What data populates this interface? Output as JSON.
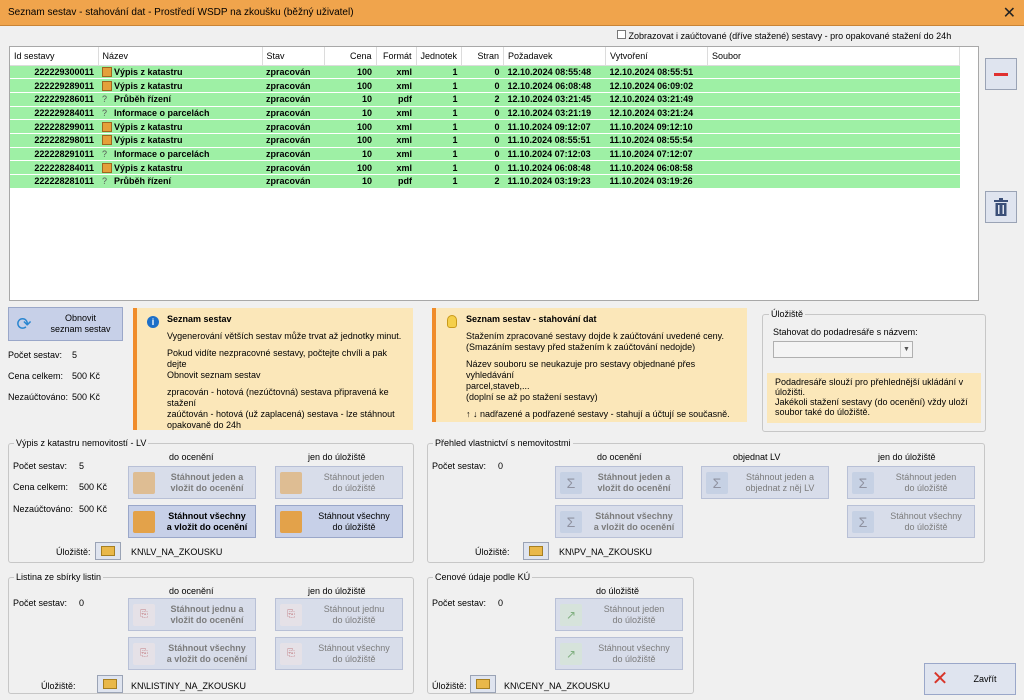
{
  "window": {
    "title": "Seznam sestav - stahování dat  - Prostředí WSDP na zkoušku (běžný uživatel)",
    "close": "✕"
  },
  "toggle_billed": "Zobrazovat i zaúčtované (dříve stažené) sestavy - pro opakované stažení do 24h",
  "grid": {
    "columns": [
      "Id sestavy",
      "Název",
      "Stav",
      "Cena",
      "Formát",
      "Jednotek",
      "Stran",
      "Požadavek",
      "Vytvoření",
      "Soubor"
    ],
    "rows": [
      {
        "id": "222229300011",
        "icon": "scroll",
        "name": "Výpis z katastru",
        "state": "zpracován",
        "price": "100",
        "format": "xml",
        "units": "1",
        "pages": "0",
        "requested": "12.10.2024 08:55:48",
        "created": "12.10.2024 08:55:51",
        "file": ""
      },
      {
        "id": "222229289011",
        "icon": "scroll",
        "name": "Výpis z katastru",
        "state": "zpracován",
        "price": "100",
        "format": "xml",
        "units": "1",
        "pages": "0",
        "requested": "12.10.2024 06:08:48",
        "created": "12.10.2024 06:09:02",
        "file": ""
      },
      {
        "id": "222229286011",
        "icon": "question",
        "name": "Průběh řízení",
        "state": "zpracován",
        "price": "10",
        "format": "pdf",
        "units": "1",
        "pages": "2",
        "requested": "12.10.2024 03:21:45",
        "created": "12.10.2024 03:21:49",
        "file": ""
      },
      {
        "id": "222229284011",
        "icon": "question",
        "name": "Informace o parcelách",
        "state": "zpracován",
        "price": "10",
        "format": "xml",
        "units": "1",
        "pages": "0",
        "requested": "12.10.2024 03:21:19",
        "created": "12.10.2024 03:21:24",
        "file": ""
      },
      {
        "id": "222228299011",
        "icon": "scroll",
        "name": "Výpis z katastru",
        "state": "zpracován",
        "price": "100",
        "format": "xml",
        "units": "1",
        "pages": "0",
        "requested": "11.10.2024 09:12:07",
        "created": "11.10.2024 09:12:10",
        "file": ""
      },
      {
        "id": "222228298011",
        "icon": "scroll",
        "name": "Výpis z katastru",
        "state": "zpracován",
        "price": "100",
        "format": "xml",
        "units": "1",
        "pages": "0",
        "requested": "11.10.2024 08:55:51",
        "created": "11.10.2024 08:55:54",
        "file": ""
      },
      {
        "id": "222228291011",
        "icon": "question",
        "name": "Informace o parcelách",
        "state": "zpracován",
        "price": "10",
        "format": "xml",
        "units": "1",
        "pages": "0",
        "requested": "11.10.2024 07:12:03",
        "created": "11.10.2024 07:12:07",
        "file": ""
      },
      {
        "id": "222228284011",
        "icon": "scroll",
        "name": "Výpis z katastru",
        "state": "zpracován",
        "price": "100",
        "format": "xml",
        "units": "1",
        "pages": "0",
        "requested": "11.10.2024 06:08:48",
        "created": "11.10.2024 06:08:58",
        "file": ""
      },
      {
        "id": "222228281011",
        "icon": "question",
        "name": "Průběh řízení",
        "state": "zpracován",
        "price": "10",
        "format": "pdf",
        "units": "1",
        "pages": "2",
        "requested": "11.10.2024 03:19:23",
        "created": "11.10.2024 03:19:26",
        "file": ""
      }
    ]
  },
  "refresh": {
    "label1": "Obnovit",
    "label2": "seznam sestav"
  },
  "stats": {
    "count_label": "Počet sestav:",
    "count": "5",
    "total_label": "Cena celkem:",
    "total": "500 Kč",
    "unbilled_label": "Nezaúčtováno:",
    "unbilled": "500 Kč"
  },
  "info1": {
    "title": "Seznam sestav",
    "p1": "Vygenerování větších sestav může trvat až jednotky minut.",
    "p2a": "Pokud vidíte nezpracovné sestavy, počtejte chvíli a pak dejte",
    "p2b": "Obnovit seznam sestav",
    "p3a": "zpracován  - hotová (nezúčtovná) sestava připravená ke",
    "p3b": "stažení",
    "p4a": "zaúčtován  - hotová (už zaplacená) sestava - lze stáhnout",
    "p4b": "opakovaně do 24h"
  },
  "info2": {
    "title": "Seznam sestav - stahování dat",
    "p1a": "Stažením zpracované sestavy dojde k zaúčtování uvedené ceny.",
    "p1b": "(Smazáním sestavy před stažením k zaúčtování nedojde)",
    "p2a": "Název souboru se neukazuje pro sestavy objednané přes vyhledávání",
    "p2b": "parcel,staveb,...",
    "p2c": "(doplní se až po stažení sestavy)",
    "p3": "↑ ↓ nadřazené a podřazené sestavy - stahují a účtují se současně."
  },
  "storage": {
    "legend": "Úložiště",
    "label": "Stahovat do podadresáře s názvem:",
    "value": "",
    "note1": "Podadresáře slouží pro přehlednější ukládání v",
    "note2": "úložišti.",
    "note3": "Jakékoli stažení sestavy (do ocenění) vždy uloží",
    "note4": "soubor také do úložiště."
  },
  "lv": {
    "legend": "Výpis z katastru nemovitostí - LV",
    "count_label": "Počet sestav:",
    "count": "5",
    "total_label": "Cena celkem:",
    "total": "500 Kč",
    "unbilled_label": "Nezaúčtováno:",
    "unbilled": "500 Kč",
    "col1": "do ocenění",
    "col2": "jen do úložiště",
    "b1a": "Stáhnout jeden a",
    "b1b": "vložit do ocenění",
    "b2a": "Stáhnout jeden",
    "b2b": "do úložiště",
    "b3a": "Stáhnout všechny",
    "b3b": "a vložit do ocenění",
    "b4a": "Stáhnout všechny",
    "b4b": "do úložiště",
    "storage_label": "Úložiště:",
    "storage_path": "KN\\LV_NA_ZKOUSKU"
  },
  "pv": {
    "legend": "Přehled vlastnictví s nemovitostmi",
    "count_label": "Počet sestav:",
    "count": "0",
    "col1": "do ocenění",
    "col2": "objednat LV",
    "col3": "jen do úložiště",
    "b1a": "Stáhnout jeden a",
    "b1b": "vložit do ocenění",
    "b2a": "Stáhnout jeden a",
    "b2b": "objednat z něj LV",
    "b3a": "Stáhnout jeden",
    "b3b": "do úložiště",
    "b4a": "Stáhnout všechny",
    "b4b": "a vložit do ocenění",
    "b5a": "Stáhnout všechny",
    "b5b": "do úložiště",
    "storage_label": "Úložiště:",
    "storage_path": "KN\\PV_NA_ZKOUSKU"
  },
  "listiny": {
    "legend": "Listina ze sbírky listin",
    "count_label": "Počet sestav:",
    "count": "0",
    "col1": "do ocenění",
    "col2": "jen do úložiště",
    "b1a": "Stáhnout jednu a",
    "b1b": "vložit do ocenění",
    "b2a": "Stáhnout jednu",
    "b2b": "do úložiště",
    "b3a": "Stáhnout všechny",
    "b3b": "a vložit do ocenění",
    "b4a": "Stáhnout všechny",
    "b4b": "do úložiště",
    "storage_label": "Úložiště:",
    "storage_path": "KN\\LISTINY_NA_ZKOUSKU"
  },
  "ceny": {
    "legend": "Cenové údaje podle KÚ",
    "count_label": "Počet sestav:",
    "count": "0",
    "col1": "do úložiště",
    "b1a": "Stáhnout jeden",
    "b1b": "do úložiště",
    "b2a": "Stáhnout všechny",
    "b2b": "do úložiště",
    "storage_label": "Úložiště:",
    "storage_path": "KN\\CENY_NA_ZKOUSKU"
  },
  "close_button": "Zavřít"
}
